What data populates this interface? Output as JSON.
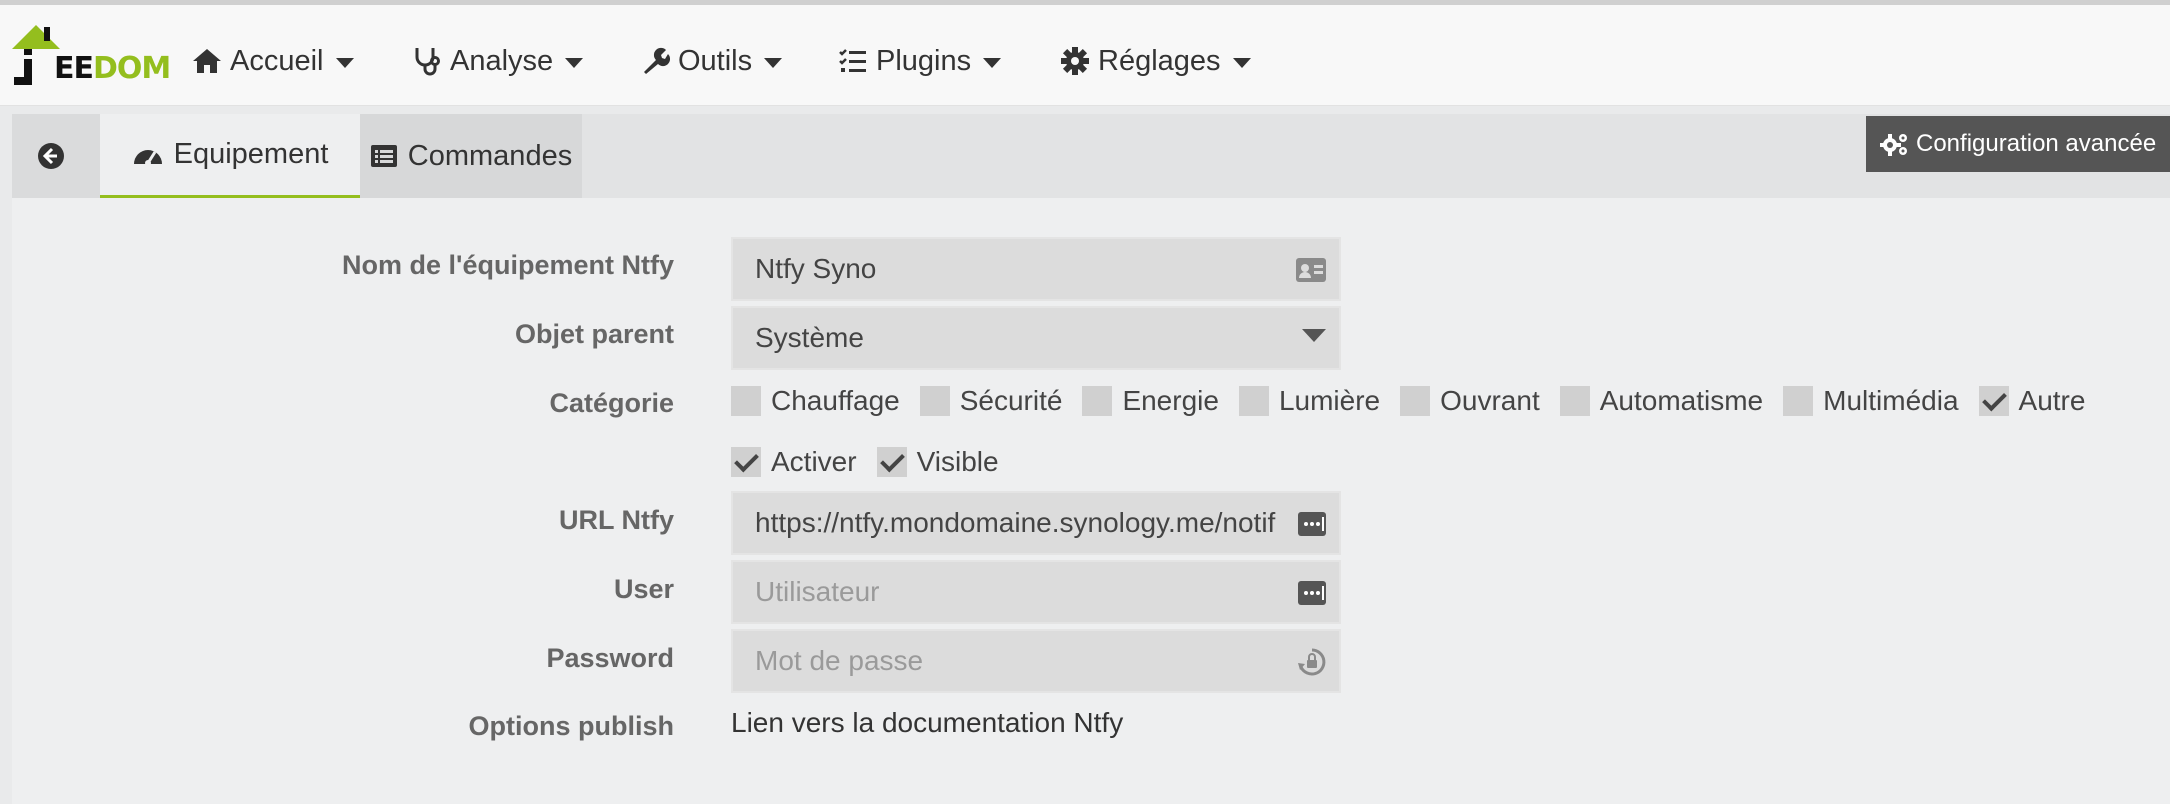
{
  "brand": {
    "logo_text_prefix": "EE",
    "logo_text_suffix": "DOM",
    "accent_color": "#94be1e"
  },
  "nav": {
    "items": [
      {
        "label": "Accueil",
        "icon": "home-icon"
      },
      {
        "label": "Analyse",
        "icon": "stethoscope-icon"
      },
      {
        "label": "Outils",
        "icon": "wrench-icon"
      },
      {
        "label": "Plugins",
        "icon": "tasks-icon"
      },
      {
        "label": "Réglages",
        "icon": "cog-icon"
      }
    ]
  },
  "tabs": {
    "back_icon": "arrow-circle-left-icon",
    "equipement": "Equipement",
    "commandes": "Commandes"
  },
  "advanced_button": {
    "label": "Configuration avancée",
    "icon": "cogs-icon"
  },
  "form": {
    "name": {
      "label": "Nom de l'équipement Ntfy",
      "value": "Ntfy Syno",
      "icon": "id-card-icon"
    },
    "parent": {
      "label": "Objet parent",
      "value": "Système"
    },
    "category": {
      "label": "Catégorie",
      "options": [
        {
          "label": "Chauffage",
          "checked": false
        },
        {
          "label": "Sécurité",
          "checked": false
        },
        {
          "label": "Energie",
          "checked": false
        },
        {
          "label": "Lumière",
          "checked": false
        },
        {
          "label": "Ouvrant",
          "checked": false
        },
        {
          "label": "Automatisme",
          "checked": false
        },
        {
          "label": "Multimédia",
          "checked": false
        },
        {
          "label": "Autre",
          "checked": true
        }
      ]
    },
    "flags": [
      {
        "label": "Activer",
        "checked": true
      },
      {
        "label": "Visible",
        "checked": true
      }
    ],
    "url": {
      "label": "URL Ntfy",
      "value": "https://ntfy.mondomaine.synology.me/notif"
    },
    "user": {
      "label": "User",
      "placeholder": "Utilisateur"
    },
    "password": {
      "label": "Password",
      "placeholder": "Mot de passe"
    },
    "options": {
      "label": "Options publish",
      "link": "Lien vers la documentation Ntfy"
    }
  }
}
